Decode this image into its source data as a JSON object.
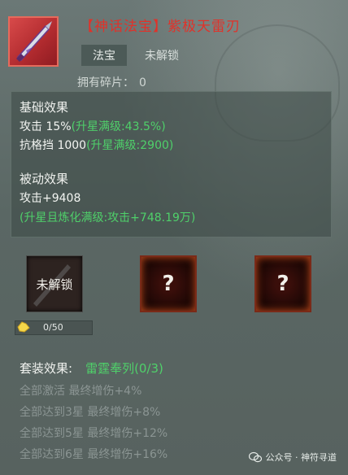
{
  "header": {
    "title": "【神话法宝】紫极天雷刃",
    "tag": "法宝",
    "status": "未解锁",
    "fragments_label": "拥有碎片：",
    "fragments_value": "0"
  },
  "basic": {
    "heading": "基础效果",
    "attack": "攻击 15%",
    "attack_max": "(升星满级:43.5%)",
    "resist": "抗格挡 1000",
    "resist_max": "(升星满级:2900)"
  },
  "passive": {
    "heading": "被动效果",
    "attack": "攻击+9408",
    "max": "(升星且炼化满级:攻击+748.19万)"
  },
  "slots": {
    "main_label": "未解锁",
    "unknown": "?",
    "progress_text": "0/50",
    "progress_fraction": 0
  },
  "set": {
    "heading": "套装效果:",
    "name": "雷霆奉列(0/3)",
    "rows": [
      "全部激活 最终增伤+4%",
      "全部达到3星 最终增伤+8%",
      "全部达到5星 最终增伤+12%",
      "全部达到6星 最终增伤+16%"
    ]
  },
  "footer": {
    "text": "公众号 · 神符寻道"
  },
  "colors": {
    "title_red": "#e0322a",
    "green": "#4fd06a",
    "muted": "#8b9593"
  }
}
